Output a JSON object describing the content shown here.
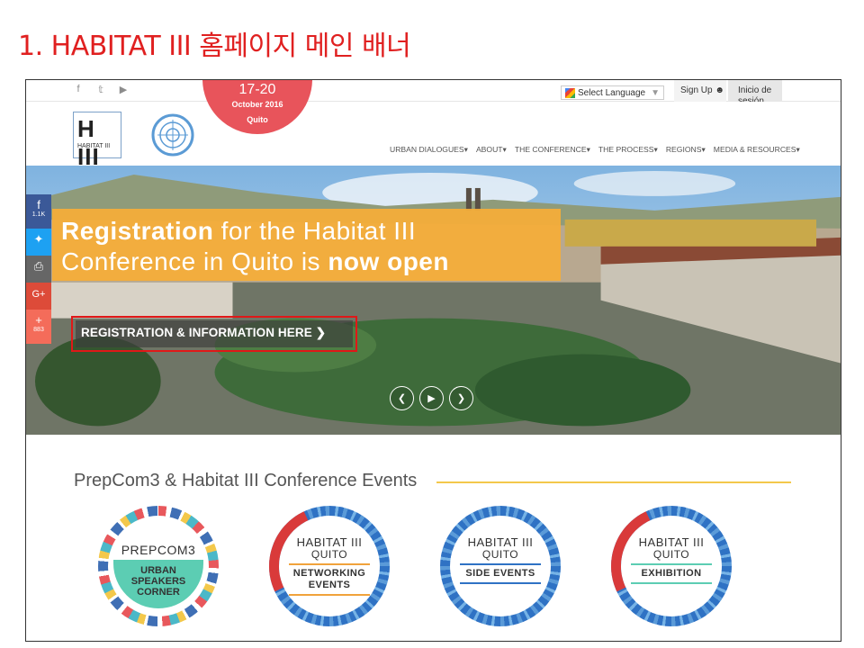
{
  "slide": {
    "title": "1. HABITAT III 홈페이지 메인 배너"
  },
  "topbar": {
    "social": [
      {
        "icon": "facebook-icon",
        "glyph": "f"
      },
      {
        "icon": "twitter-icon",
        "glyph": "𝕥"
      },
      {
        "icon": "youtube-icon",
        "glyph": "▶"
      }
    ],
    "date_range": "17-20",
    "date_month": "October 2016",
    "date_city": "Quito",
    "language_label": "Select Language",
    "language_arrow": "▼",
    "signup_label": "Sign Up",
    "signin_label": "Inicio de sesión"
  },
  "header": {
    "logo_text": "H III",
    "logo_sub": "HABITAT III",
    "nav": [
      "URBAN DIALOGUES▾",
      "ABOUT▾",
      "THE CONFERENCE▾",
      "THE PROCESS▾",
      "REGIONS▾",
      "MEDIA & RESOURCES▾"
    ]
  },
  "hero": {
    "banner_line1_light": "for the Habitat III",
    "banner_line1_bold": "Registration",
    "banner_line2_light": "Conference in Quito is",
    "banner_line2_bold": "now open",
    "cta_label": "REGISTRATION & INFORMATION HERE ❯",
    "share": {
      "fb_count": "1.1K",
      "plus_count": "883"
    },
    "controls": [
      "❮",
      "▶",
      "❯"
    ]
  },
  "events": {
    "title": "PrepCom3 & Habitat III Conference Events",
    "badges": [
      {
        "top": "PREPCOM3",
        "label": "URBAN SPEAKERS CORNER"
      },
      {
        "top": "HABITAT III",
        "sub": "QUITO",
        "label": "NETWORKING EVENTS"
      },
      {
        "top": "HABITAT III",
        "sub": "QUITO",
        "label": "SIDE EVENTS"
      },
      {
        "top": "HABITAT III",
        "sub": "QUITO",
        "label": "EXHIBITION"
      }
    ]
  }
}
